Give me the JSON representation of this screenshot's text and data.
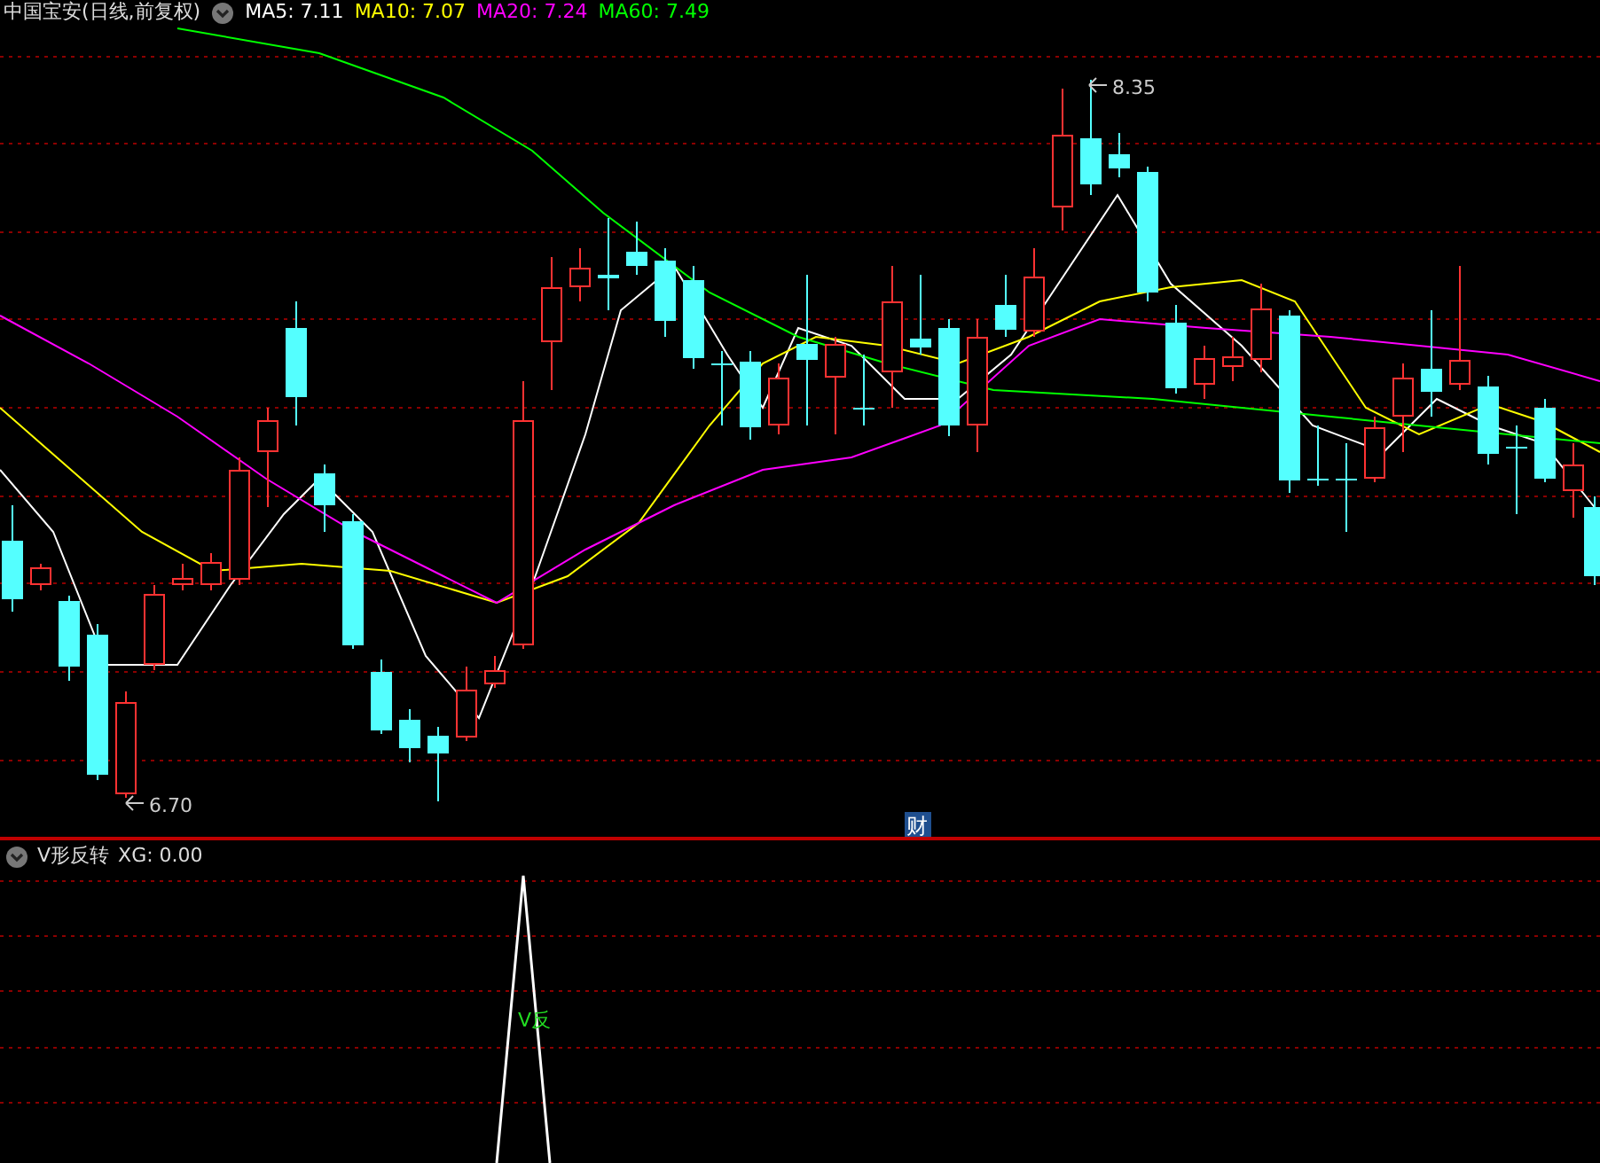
{
  "main_panel": {
    "title": "中国宝安(日线,前复权)",
    "indicators": [
      {
        "label": "MA5: 7.11",
        "color": "#ffffff"
      },
      {
        "label": "MA10: 7.07",
        "color": "#ffff00"
      },
      {
        "label": "MA20: 7.24",
        "color": "#ff00ff"
      },
      {
        "label": "MA60: 7.49",
        "color": "#00ff00"
      }
    ],
    "high_label": "8.35",
    "low_label": "6.70",
    "event_marker": "财"
  },
  "indicator_panel": {
    "title": "V形反转",
    "reading": "XG: 0.00",
    "signal_label": "V反"
  }
}
